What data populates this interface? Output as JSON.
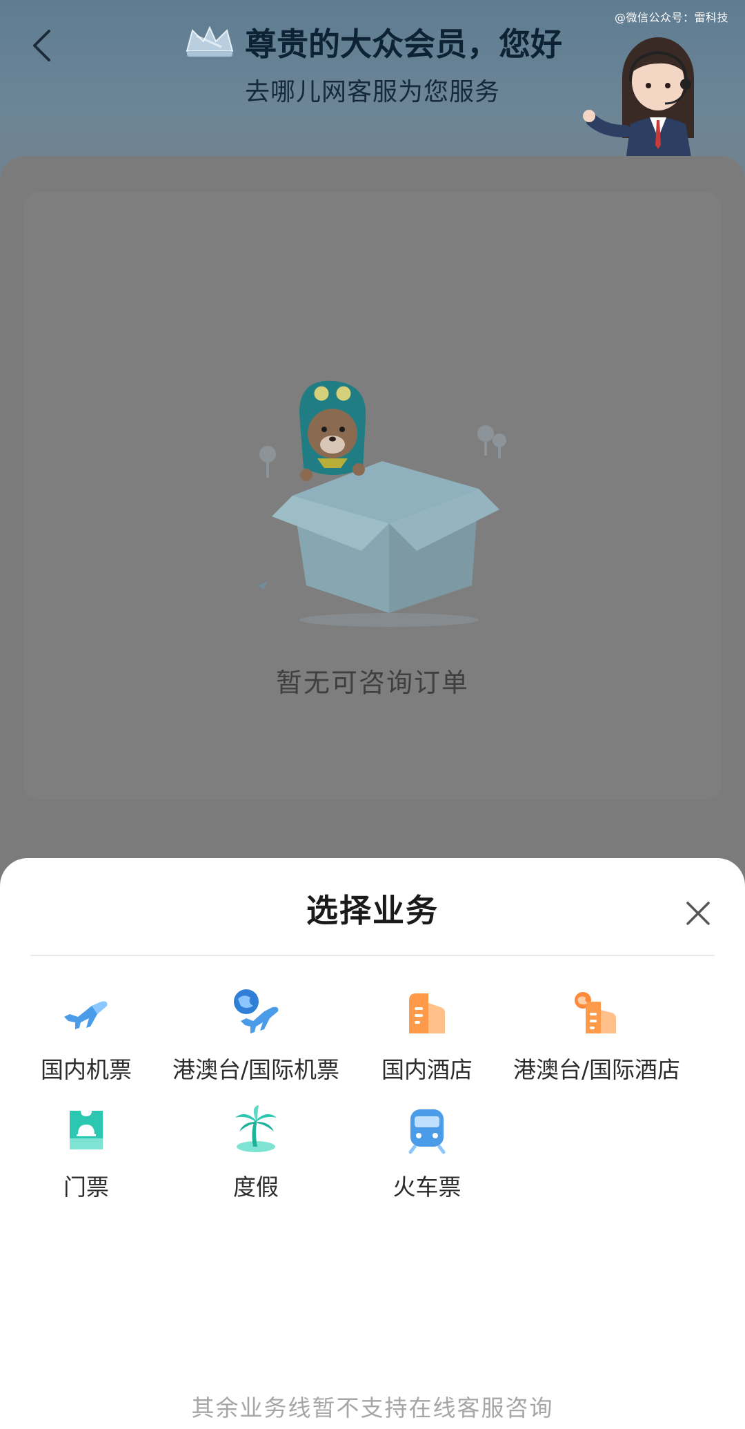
{
  "header": {
    "watermark": "@微信公众号：雷科技",
    "title": "尊贵的大众会员，您好",
    "subtitle": "去哪儿网客服为您服务"
  },
  "main": {
    "empty_text": "暂无可咨询订单"
  },
  "sheet": {
    "title": "选择业务",
    "services": [
      {
        "label": "国内机票",
        "icon": "plane-icon"
      },
      {
        "label": "港澳台/国际机票",
        "icon": "globe-plane-icon"
      },
      {
        "label": "国内酒店",
        "icon": "hotel-icon"
      },
      {
        "label": "港澳台/国际酒店",
        "icon": "intl-hotel-icon"
      },
      {
        "label": "门票",
        "icon": "ticket-icon"
      },
      {
        "label": "度假",
        "icon": "palm-island-icon"
      },
      {
        "label": "火车票",
        "icon": "train-icon"
      }
    ],
    "footnote": "其余业务线暂不支持在线客服咨询"
  },
  "colors": {
    "blue_icon": "#4a9be8",
    "orange_icon": "#ff9a4a",
    "teal_icon": "#2cc7b0",
    "overlay_gray": "#7b7b7b"
  }
}
